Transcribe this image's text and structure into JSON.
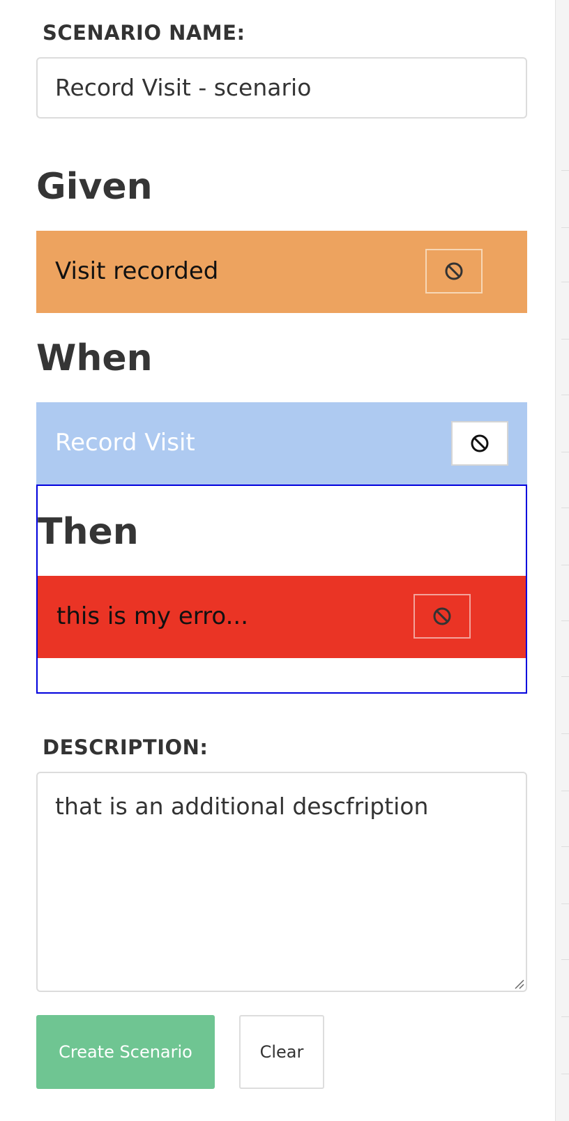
{
  "scenario_name": {
    "label": "SCENARIO NAME:",
    "value": "Record Visit - scenario"
  },
  "given": {
    "heading": "Given",
    "step_text": "Visit recorded",
    "color": "#eda35f",
    "remove_icon": "block-icon"
  },
  "when": {
    "heading": "When",
    "step_text": "Record Visit",
    "color": "#aecaf1",
    "remove_icon": "block-icon"
  },
  "then": {
    "heading": "Then",
    "step_text": "this is my erro...",
    "color": "#ea3425",
    "drop_zone_border": "#0000dd",
    "remove_icon": "block-icon"
  },
  "description": {
    "label": "DESCRIPTION:",
    "value": "that is an additional descfription"
  },
  "actions": {
    "create_label": "Create Scenario",
    "create_color": "#6fc592",
    "clear_label": "Clear"
  }
}
